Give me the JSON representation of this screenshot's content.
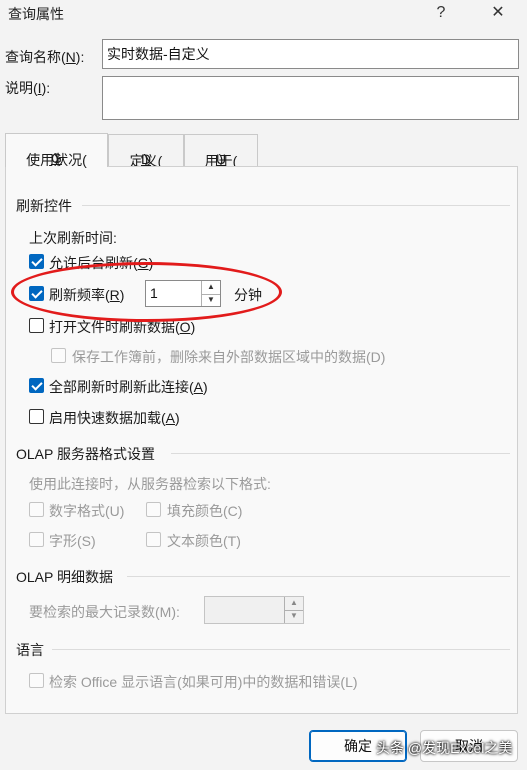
{
  "window": {
    "title": "查询属性",
    "help_glyph": "?",
    "close_glyph": "✕"
  },
  "name_field": {
    "label": "查询名称(",
    "label_key": "N",
    "label_suffix": "):",
    "value": "实时数据-自定义"
  },
  "desc_field": {
    "label": "说明(",
    "label_key": "I",
    "label_suffix": "):",
    "value": ""
  },
  "tabs": [
    {
      "label": "使用状况(",
      "key": "G",
      "suffix": ")"
    },
    {
      "label": "定义(",
      "key": "D",
      "suffix": ")"
    },
    {
      "label": "用于(",
      "key": "U",
      "suffix": ")"
    }
  ],
  "refresh": {
    "section_title": "刷新控件",
    "last_refresh_label": "上次刷新时间:",
    "background": {
      "label": "允许后台刷新(",
      "key": "G",
      "suffix": ")",
      "checked": true
    },
    "frequency": {
      "label": "刷新频率(",
      "key": "R",
      "suffix": ")",
      "checked": true,
      "value": "1",
      "unit": "分钟"
    },
    "on_open": {
      "label": "打开文件时刷新数据(",
      "key": "O",
      "suffix": ")",
      "checked": false
    },
    "save_sub": {
      "label": "保存工作簿前，删除来自外部数据区域中的数据(D)",
      "checked": false
    },
    "remove_conn": {
      "label": "全部刷新时刷新此连接(",
      "key": "A",
      "suffix": ")",
      "checked": true
    },
    "fast_load": {
      "label": "启用快速数据加载(",
      "key": "A",
      "suffix": ")",
      "checked": false
    }
  },
  "olap_format": {
    "section_title": "OLAP 服务器格式设置",
    "hint": "使用此连接时，从服务器检索以下格式:",
    "number_format": "数字格式(U)",
    "fill_color": "填充颜色(C)",
    "font_style": "字形(S)",
    "text_color": "文本颜色(T)"
  },
  "olap_detail": {
    "section_title": "OLAP 明细数据",
    "max_records_label": "要检索的最大记录数(M):",
    "max_records_value": ""
  },
  "language": {
    "section_title": "语言",
    "retrieve_label": "检索 Office 显示语言(如果可用)中的数据和错误(L)"
  },
  "buttons": {
    "ok": "确定",
    "cancel": "取消"
  },
  "watermark": "头条 @发现Excel之美",
  "colors": {
    "accent": "#0067c0",
    "highlight_ring": "#e21b1b"
  }
}
